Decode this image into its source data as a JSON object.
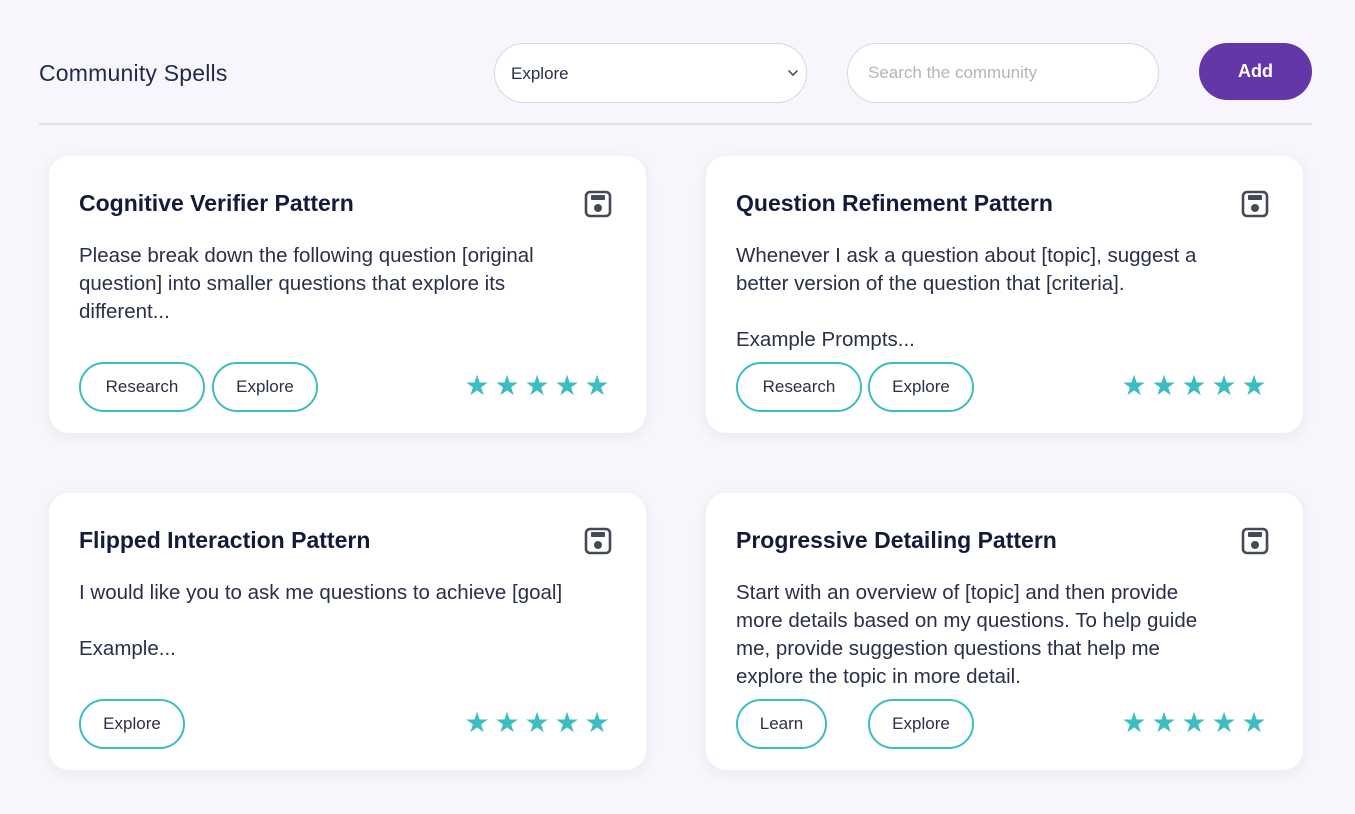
{
  "header": {
    "title": "Community Spells",
    "filter_value": "Explore",
    "search_placeholder": "Search the community",
    "add_label": "Add"
  },
  "cards": [
    {
      "title": "Cognitive Verifier Pattern",
      "description": "Please break down the following question [original\nquestion] into smaller questions that explore its\ndifferent...",
      "tags": [
        "Research",
        "Explore"
      ],
      "rating": 5
    },
    {
      "title": "Question Refinement Pattern",
      "description": "Whenever I ask a question about [topic], suggest a\nbetter version of the question that [criteria].\n\nExample Prompts...",
      "tags": [
        "Research",
        "Explore"
      ],
      "rating": 5
    },
    {
      "title": "Flipped Interaction Pattern",
      "description": "I would like you to ask me questions to achieve [goal]\n\nExample...",
      "tags": [
        "Explore"
      ],
      "rating": 5
    },
    {
      "title": "Progressive Detailing Pattern",
      "description": "Start with an overview of [topic] and then provide\nmore details based on my questions. To help guide\nme, provide suggestion questions that help me\nexplore the topic in more detail.",
      "tags": [
        "Learn",
        "Explore"
      ],
      "rating": 5
    }
  ],
  "icons": {
    "save": "save-icon",
    "star": "star-icon",
    "dropdown": "chevron-down-icon"
  },
  "colors": {
    "accent_teal": "#3bbdc2",
    "add_button": "#6437a8",
    "background": "#f8f6fc"
  }
}
